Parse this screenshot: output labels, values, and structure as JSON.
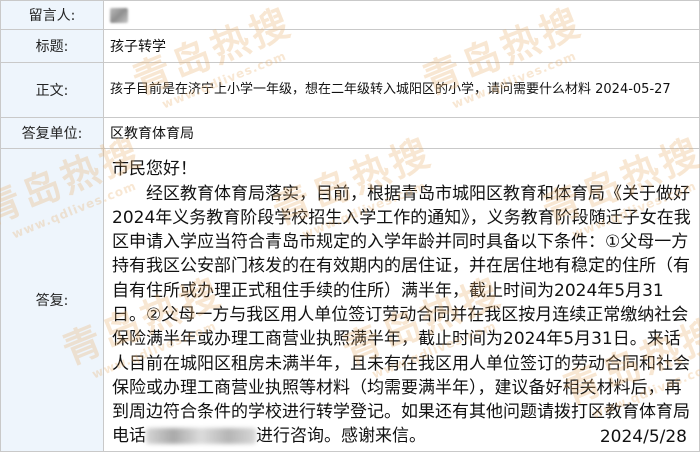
{
  "fields": {
    "author_label": "留言人:",
    "title_label": "标题:",
    "title_value": "孩子转学",
    "body_label": "正文:",
    "body_value": "孩子目前是在济宁上小学一年级，想在二年级转入城阳区的小学，请问需要什么材料  2024-05-27",
    "reply_unit_label": "答复单位:",
    "reply_unit_value": "区教育体育局",
    "reply_label": "答复:"
  },
  "reply": {
    "greeting": "市民您好！",
    "before_phone": "经区教育体育局落实，目前，根据青岛市城阳区教育和体育局《关于做好2024年义务教育阶段学校招生入学工作的通知》，义务教育阶段随迁子女在我区申请入学应当符合青岛市规定的入学年龄并同时具备以下条件：①父母一方持有我区公安部门核发的在有效期内的居住证，并在居住地有稳定的住所（有自有住所或办理正式租住手续的住所）满半年，截止时间为2024年5月31日。②父母一方与我区用人单位签订劳动合同并在我区按月连续正常缴纳社会保险满半年或办理工商营业执照满半年，截止时间为2024年5月31日。来话人目前在城阳区租房未满半年，且未有在我区用人单位签订的劳动合同和社会保险或办理工商营业执照等材料（均需要满半年），建议备好相关材料后，再到周边符合条件的学校进行转学登记。如果还有其他问题请拨打区教育体育局电话",
    "after_phone": "进行咨询。感谢来信。",
    "date": "2024/5/28"
  },
  "watermark": {
    "text": "青岛热搜",
    "url": "www.qdlives.com",
    "color": "#e8b06e"
  }
}
